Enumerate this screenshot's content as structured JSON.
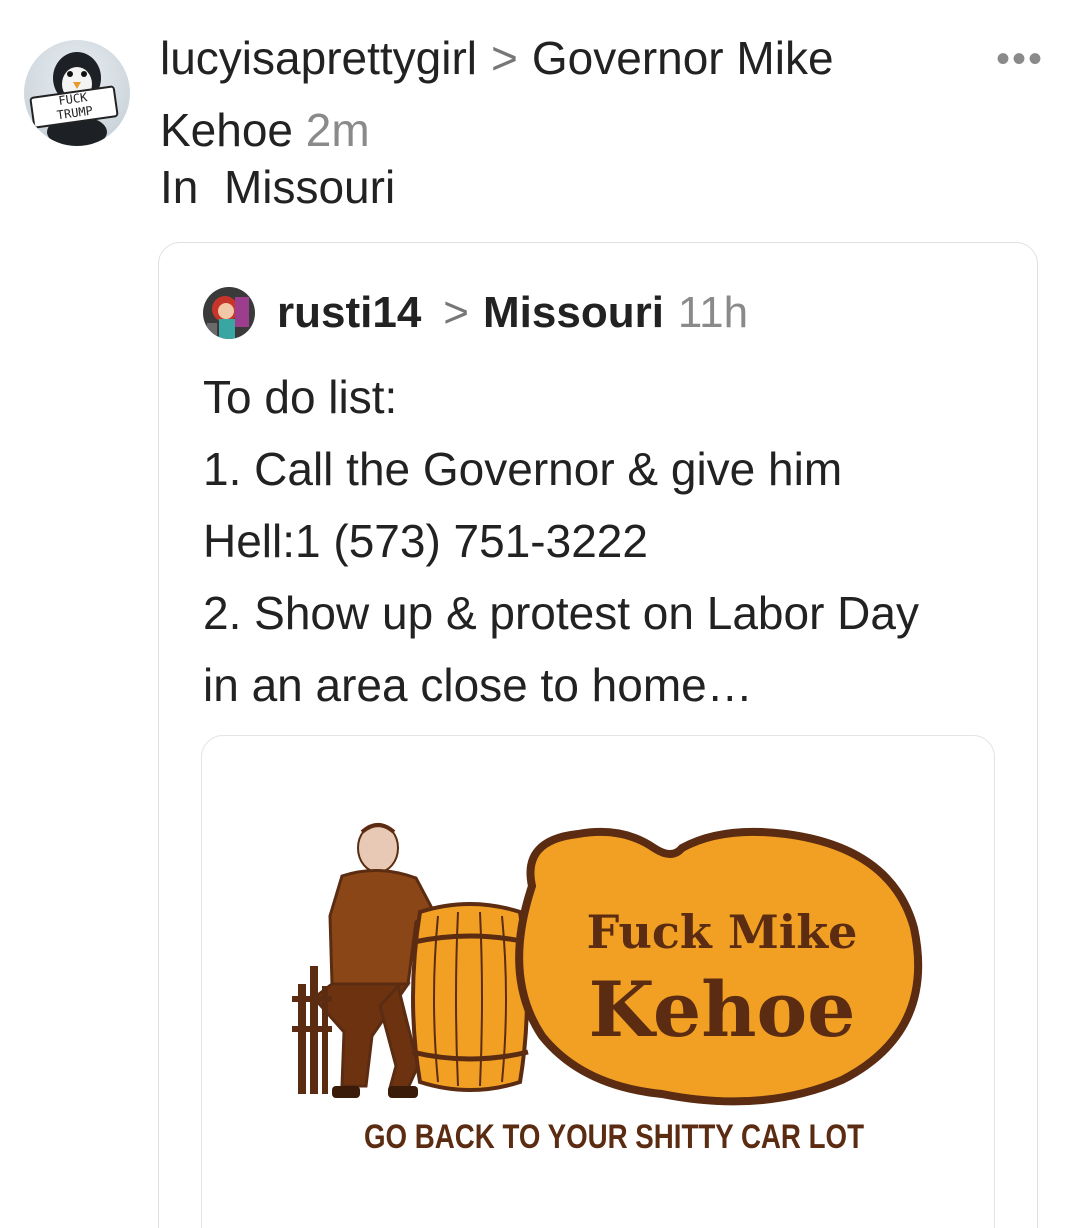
{
  "post": {
    "author": "lucyisaprettygirl",
    "destination_line1": "Governor Mike",
    "destination_line2": "Kehoe",
    "time": "2m",
    "community_prefix": "In",
    "community": "Missouri",
    "avatar_sign_line1": "FUCK",
    "avatar_sign_line2": "TRUMP",
    "more_label": "•••"
  },
  "quoted": {
    "author": "rusti14",
    "destination": "Missouri",
    "time": "11h",
    "lines": [
      "To do list:",
      "1. Call the Governor & give him",
      "Hell:1 (573) 751-3222",
      "2. Show up & protest on Labor Day",
      "in an area close to home…"
    ],
    "image": {
      "logo_line1": "Fuck Mike",
      "logo_line2": "Kehoe",
      "caption": "GO BACK TO YOUR SHITTY CAR LOT"
    }
  },
  "colors": {
    "logo_orange": "#f2a024",
    "logo_brown": "#5b2c12",
    "muted_text": "#8a8a8a",
    "border": "#e0e0e0"
  },
  "icons": {
    "more": "more-horizontal-icon",
    "chevron": "chevron-right-icon"
  }
}
